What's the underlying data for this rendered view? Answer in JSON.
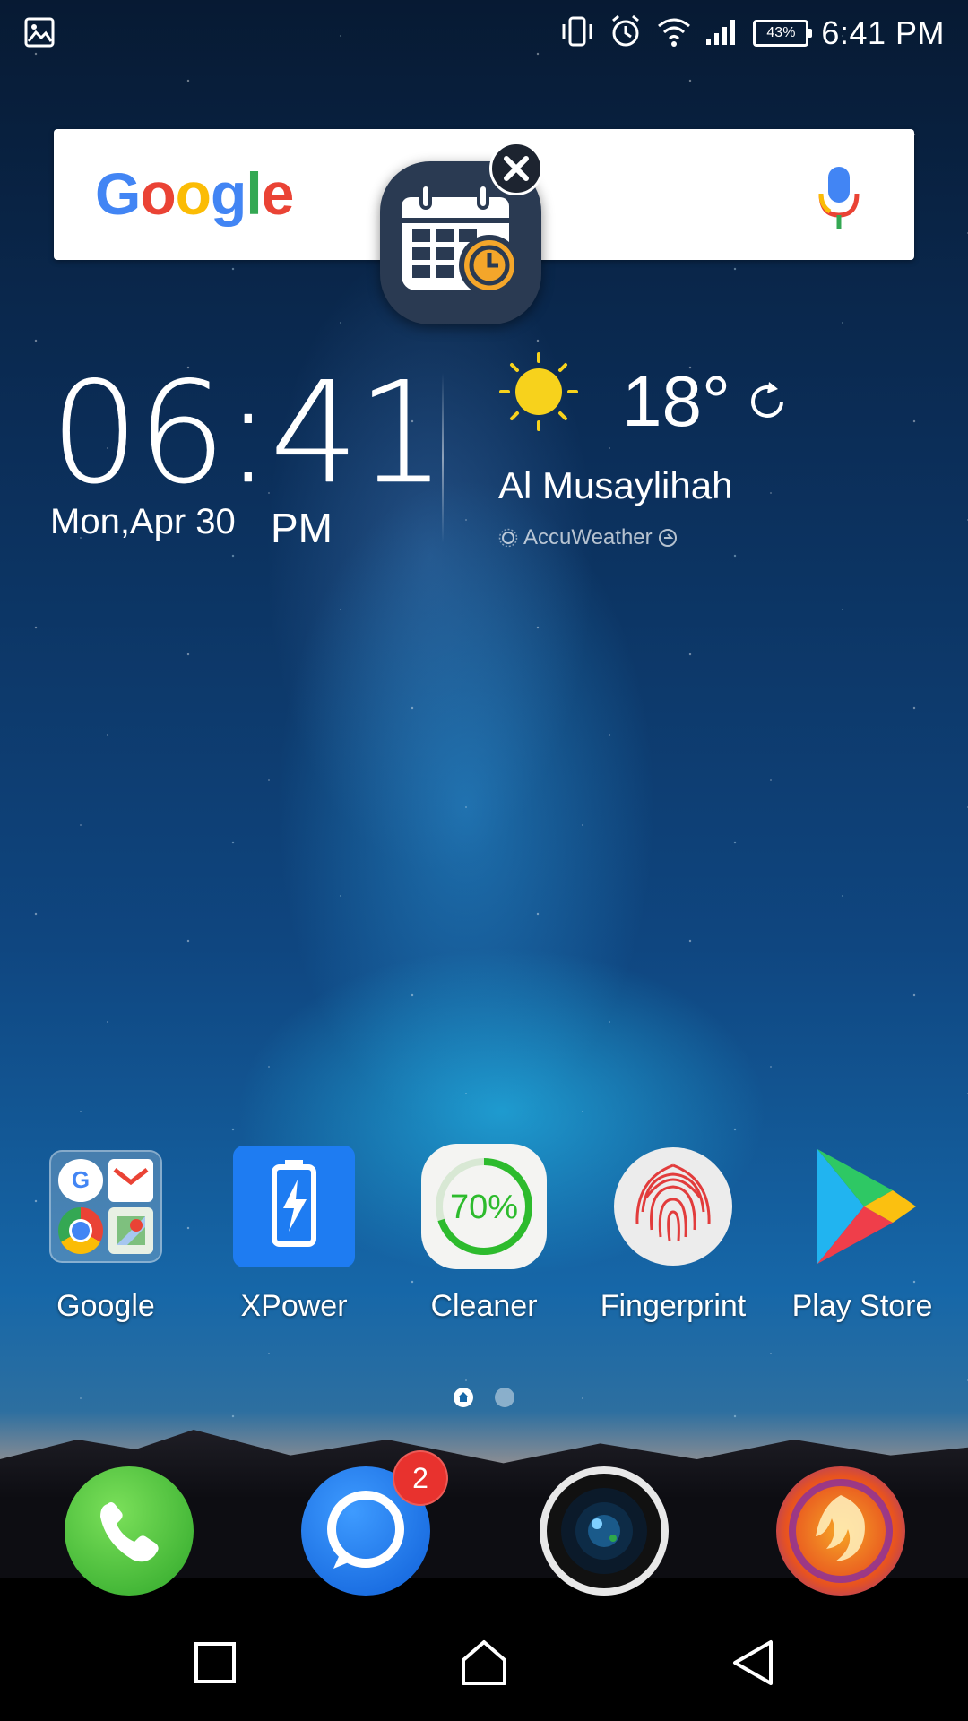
{
  "status_bar": {
    "time": "6:41 PM",
    "battery_percent": "43%",
    "icons": [
      "image-notification-icon",
      "vibrate-icon",
      "alarm-icon",
      "wifi-icon",
      "signal-icon",
      "battery-icon"
    ]
  },
  "search": {
    "logo_letters": [
      "G",
      "o",
      "o",
      "g",
      "l",
      "e"
    ],
    "logo_colors": [
      "#4285F4",
      "#EA4335",
      "#FBBC05",
      "#4285F4",
      "#34A853",
      "#EA4335"
    ]
  },
  "floating_bubble": {
    "icon": "calendar-clock-icon",
    "close_icon": "close-icon"
  },
  "clock_widget": {
    "time": "06:41",
    "date": "Mon,Apr 30",
    "ampm": "PM"
  },
  "weather_widget": {
    "icon": "sun-icon",
    "temperature": "18°",
    "city": "Al Musaylihah",
    "provider": "AccuWeather"
  },
  "apps": [
    {
      "label": "Google",
      "icon": "google-folder-icon"
    },
    {
      "label": "XPower",
      "icon": "battery-bolt-icon"
    },
    {
      "label": "Cleaner",
      "icon": "cleaner-icon",
      "percent": "70%"
    },
    {
      "label": "Fingerprint",
      "icon": "fingerprint-icon"
    },
    {
      "label": "Play Store",
      "icon": "play-store-icon"
    }
  ],
  "page_indicator": {
    "pages": 2,
    "active": 1
  },
  "dock": [
    {
      "name": "phone",
      "icon": "phone-icon"
    },
    {
      "name": "messages",
      "icon": "message-icon",
      "badge": "2"
    },
    {
      "name": "camera",
      "icon": "camera-icon"
    },
    {
      "name": "browser",
      "icon": "phoenix-browser-icon"
    }
  ],
  "nav_bar": [
    "recents-button",
    "home-button",
    "back-button"
  ]
}
